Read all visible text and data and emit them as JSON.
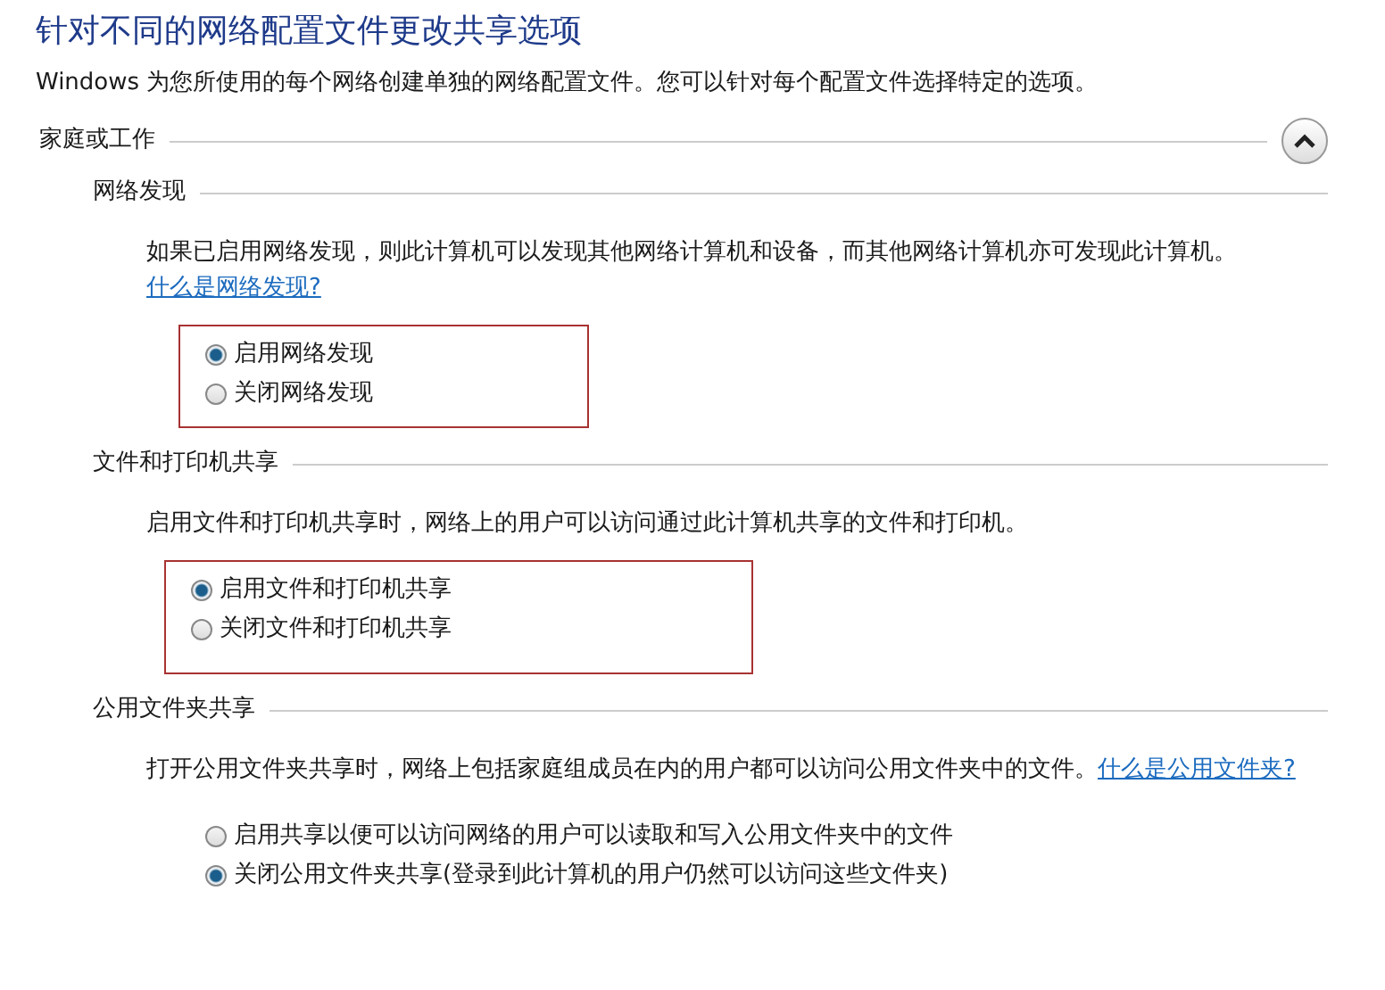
{
  "title": "针对不同的网络配置文件更改共享选项",
  "intro": "Windows 为您所使用的每个网络创建单独的网络配置文件。您可以针对每个配置文件选择特定的选项。",
  "profile": {
    "label": "家庭或工作",
    "expanded": true
  },
  "sections": [
    {
      "heading": "网络发现",
      "description": "如果已启用网络发现，则此计算机可以发现其他网络计算机和设备，而其他网络计算机亦可发现此计算机。",
      "link": "什么是网络发现?",
      "highlighted": true,
      "options": [
        {
          "label": "启用网络发现",
          "selected": true
        },
        {
          "label": "关闭网络发现",
          "selected": false
        }
      ]
    },
    {
      "heading": "文件和打印机共享",
      "description": "启用文件和打印机共享时，网络上的用户可以访问通过此计算机共享的文件和打印机。",
      "highlighted": true,
      "options": [
        {
          "label": "启用文件和打印机共享",
          "selected": true
        },
        {
          "label": "关闭文件和打印机共享",
          "selected": false
        }
      ]
    },
    {
      "heading": "公用文件夹共享",
      "description": "打开公用文件夹共享时，网络上包括家庭组成员在内的用户都可以访问公用文件夹中的文件。",
      "link": "什么是公用文件夹?",
      "highlighted": false,
      "options": [
        {
          "label": "启用共享以便可以访问网络的用户可以读取和写入公用文件夹中的文件",
          "selected": false
        },
        {
          "label": "关闭公用文件夹共享(登录到此计算机的用户仍然可以访问这些文件夹)",
          "selected": true
        }
      ]
    }
  ]
}
